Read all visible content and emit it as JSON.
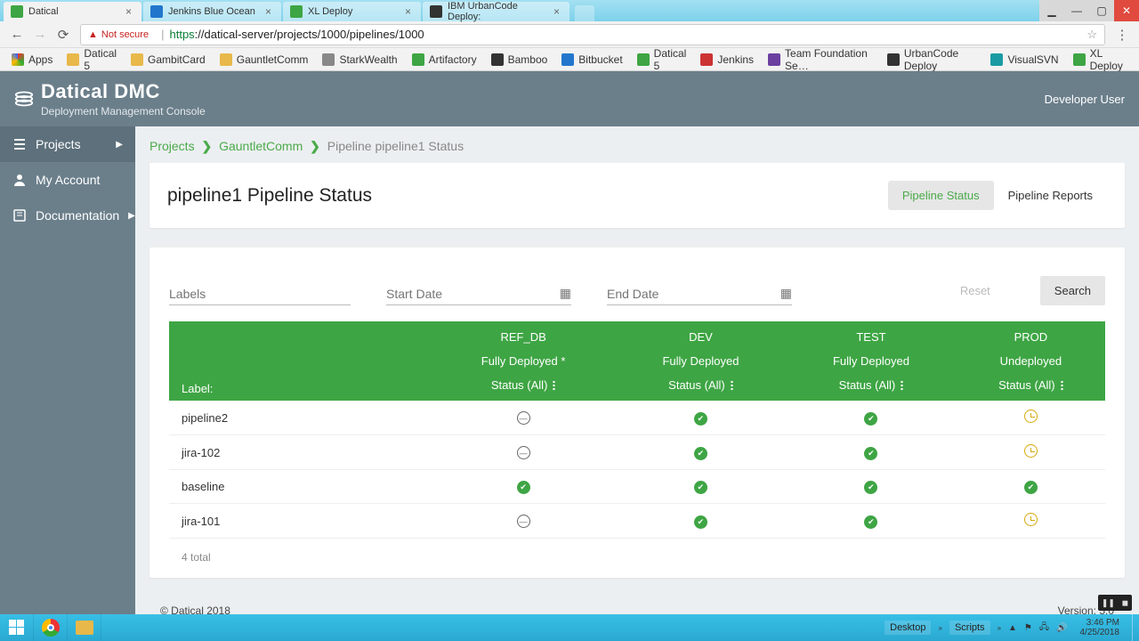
{
  "browser": {
    "tabs": [
      {
        "title": "Datical",
        "active": true
      },
      {
        "title": "Jenkins Blue Ocean",
        "active": false
      },
      {
        "title": "XL Deploy",
        "active": false
      },
      {
        "title": "IBM UrbanCode Deploy:",
        "active": false
      }
    ],
    "security_label": "Not secure",
    "url_scheme": "https",
    "url_rest": "://datical-server/projects/1000/pipelines/1000",
    "bookmarks": [
      "Apps",
      "Datical 5",
      "GambitCard",
      "GauntletComm",
      "StarkWealth",
      "Artifactory",
      "Bamboo",
      "Bitbucket",
      "Datical 5",
      "Jenkins",
      "Team Foundation Se…",
      "UrbanCode Deploy",
      "VisualSVN",
      "XL Deploy"
    ]
  },
  "app": {
    "brand": "Datical DMC",
    "subtitle": "Deployment Management Console",
    "user": "Developer User",
    "sidebar": [
      {
        "label": "Projects",
        "expandable": true,
        "active": true
      },
      {
        "label": "My Account",
        "expandable": false,
        "active": false
      },
      {
        "label": "Documentation",
        "expandable": true,
        "active": false
      }
    ],
    "breadcrumbs": {
      "root": "Projects",
      "project": "GauntletComm",
      "current": "Pipeline pipeline1 Status"
    },
    "page_title": "pipeline1 Pipeline Status",
    "tabs": {
      "status": "Pipeline Status",
      "reports": "Pipeline Reports"
    },
    "filters": {
      "labels_placeholder": "Labels",
      "start_placeholder": "Start Date",
      "end_placeholder": "End Date",
      "reset": "Reset",
      "search": "Search"
    },
    "grid": {
      "label_header": "Label:",
      "status_filter": "Status (All)",
      "envs": [
        {
          "name": "REF_DB",
          "state": "Fully Deployed *"
        },
        {
          "name": "DEV",
          "state": "Fully Deployed"
        },
        {
          "name": "TEST",
          "state": "Fully Deployed"
        },
        {
          "name": "PROD",
          "state": "Undeployed"
        }
      ],
      "rows": [
        {
          "label": "pipeline2",
          "status": [
            "dash",
            "ok",
            "ok",
            "clock"
          ]
        },
        {
          "label": "jira-102",
          "status": [
            "dash",
            "ok",
            "ok",
            "clock"
          ]
        },
        {
          "label": "baseline",
          "status": [
            "ok",
            "ok",
            "ok",
            "ok"
          ]
        },
        {
          "label": "jira-101",
          "status": [
            "dash",
            "ok",
            "ok",
            "clock"
          ]
        }
      ],
      "total": "4 total"
    },
    "footer": {
      "copyright": "© Datical 2018",
      "version": "Version: 5.0"
    }
  },
  "taskbar": {
    "tray_labels": [
      "Desktop",
      "Scripts"
    ],
    "time": "3:46 PM",
    "date": "4/25/2018"
  }
}
